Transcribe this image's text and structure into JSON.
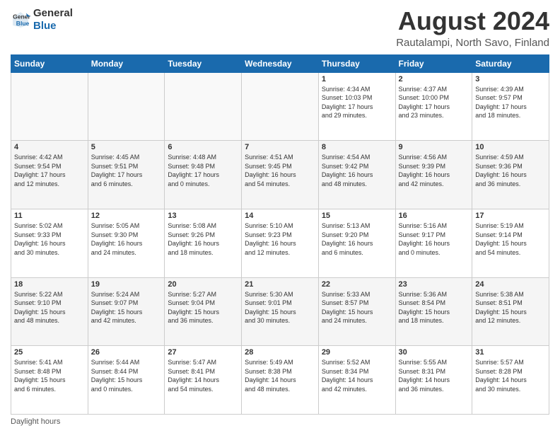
{
  "logo": {
    "line1": "General",
    "line2": "Blue"
  },
  "header": {
    "title": "August 2024",
    "subtitle": "Rautalampi, North Savo, Finland"
  },
  "days_of_week": [
    "Sunday",
    "Monday",
    "Tuesday",
    "Wednesday",
    "Thursday",
    "Friday",
    "Saturday"
  ],
  "footer": {
    "label": "Daylight hours"
  },
  "weeks": [
    [
      {
        "day": "",
        "info": ""
      },
      {
        "day": "",
        "info": ""
      },
      {
        "day": "",
        "info": ""
      },
      {
        "day": "",
        "info": ""
      },
      {
        "day": "1",
        "info": "Sunrise: 4:34 AM\nSunset: 10:03 PM\nDaylight: 17 hours\nand 29 minutes."
      },
      {
        "day": "2",
        "info": "Sunrise: 4:37 AM\nSunset: 10:00 PM\nDaylight: 17 hours\nand 23 minutes."
      },
      {
        "day": "3",
        "info": "Sunrise: 4:39 AM\nSunset: 9:57 PM\nDaylight: 17 hours\nand 18 minutes."
      }
    ],
    [
      {
        "day": "4",
        "info": "Sunrise: 4:42 AM\nSunset: 9:54 PM\nDaylight: 17 hours\nand 12 minutes."
      },
      {
        "day": "5",
        "info": "Sunrise: 4:45 AM\nSunset: 9:51 PM\nDaylight: 17 hours\nand 6 minutes."
      },
      {
        "day": "6",
        "info": "Sunrise: 4:48 AM\nSunset: 9:48 PM\nDaylight: 17 hours\nand 0 minutes."
      },
      {
        "day": "7",
        "info": "Sunrise: 4:51 AM\nSunset: 9:45 PM\nDaylight: 16 hours\nand 54 minutes."
      },
      {
        "day": "8",
        "info": "Sunrise: 4:54 AM\nSunset: 9:42 PM\nDaylight: 16 hours\nand 48 minutes."
      },
      {
        "day": "9",
        "info": "Sunrise: 4:56 AM\nSunset: 9:39 PM\nDaylight: 16 hours\nand 42 minutes."
      },
      {
        "day": "10",
        "info": "Sunrise: 4:59 AM\nSunset: 9:36 PM\nDaylight: 16 hours\nand 36 minutes."
      }
    ],
    [
      {
        "day": "11",
        "info": "Sunrise: 5:02 AM\nSunset: 9:33 PM\nDaylight: 16 hours\nand 30 minutes."
      },
      {
        "day": "12",
        "info": "Sunrise: 5:05 AM\nSunset: 9:30 PM\nDaylight: 16 hours\nand 24 minutes."
      },
      {
        "day": "13",
        "info": "Sunrise: 5:08 AM\nSunset: 9:26 PM\nDaylight: 16 hours\nand 18 minutes."
      },
      {
        "day": "14",
        "info": "Sunrise: 5:10 AM\nSunset: 9:23 PM\nDaylight: 16 hours\nand 12 minutes."
      },
      {
        "day": "15",
        "info": "Sunrise: 5:13 AM\nSunset: 9:20 PM\nDaylight: 16 hours\nand 6 minutes."
      },
      {
        "day": "16",
        "info": "Sunrise: 5:16 AM\nSunset: 9:17 PM\nDaylight: 16 hours\nand 0 minutes."
      },
      {
        "day": "17",
        "info": "Sunrise: 5:19 AM\nSunset: 9:14 PM\nDaylight: 15 hours\nand 54 minutes."
      }
    ],
    [
      {
        "day": "18",
        "info": "Sunrise: 5:22 AM\nSunset: 9:10 PM\nDaylight: 15 hours\nand 48 minutes."
      },
      {
        "day": "19",
        "info": "Sunrise: 5:24 AM\nSunset: 9:07 PM\nDaylight: 15 hours\nand 42 minutes."
      },
      {
        "day": "20",
        "info": "Sunrise: 5:27 AM\nSunset: 9:04 PM\nDaylight: 15 hours\nand 36 minutes."
      },
      {
        "day": "21",
        "info": "Sunrise: 5:30 AM\nSunset: 9:01 PM\nDaylight: 15 hours\nand 30 minutes."
      },
      {
        "day": "22",
        "info": "Sunrise: 5:33 AM\nSunset: 8:57 PM\nDaylight: 15 hours\nand 24 minutes."
      },
      {
        "day": "23",
        "info": "Sunrise: 5:36 AM\nSunset: 8:54 PM\nDaylight: 15 hours\nand 18 minutes."
      },
      {
        "day": "24",
        "info": "Sunrise: 5:38 AM\nSunset: 8:51 PM\nDaylight: 15 hours\nand 12 minutes."
      }
    ],
    [
      {
        "day": "25",
        "info": "Sunrise: 5:41 AM\nSunset: 8:48 PM\nDaylight: 15 hours\nand 6 minutes."
      },
      {
        "day": "26",
        "info": "Sunrise: 5:44 AM\nSunset: 8:44 PM\nDaylight: 15 hours\nand 0 minutes."
      },
      {
        "day": "27",
        "info": "Sunrise: 5:47 AM\nSunset: 8:41 PM\nDaylight: 14 hours\nand 54 minutes."
      },
      {
        "day": "28",
        "info": "Sunrise: 5:49 AM\nSunset: 8:38 PM\nDaylight: 14 hours\nand 48 minutes."
      },
      {
        "day": "29",
        "info": "Sunrise: 5:52 AM\nSunset: 8:34 PM\nDaylight: 14 hours\nand 42 minutes."
      },
      {
        "day": "30",
        "info": "Sunrise: 5:55 AM\nSunset: 8:31 PM\nDaylight: 14 hours\nand 36 minutes."
      },
      {
        "day": "31",
        "info": "Sunrise: 5:57 AM\nSunset: 8:28 PM\nDaylight: 14 hours\nand 30 minutes."
      }
    ]
  ]
}
